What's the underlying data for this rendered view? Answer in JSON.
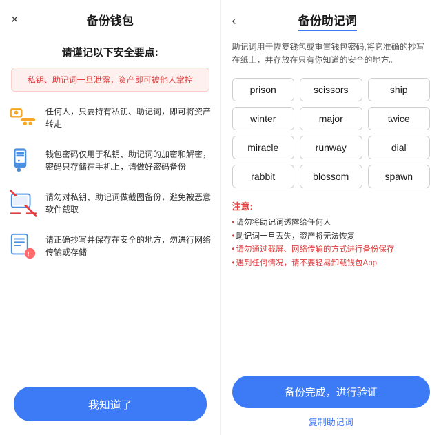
{
  "left": {
    "close_icon": "×",
    "title": "备份钱包",
    "subtitle": "请谨记以下安全要点:",
    "warning": "私钥、助记词一旦泄露，资产即可被他人掌控",
    "security_items": [
      {
        "id": "item1",
        "text": "任何人，只要持有私钥、助记词，即可将资产转走"
      },
      {
        "id": "item2",
        "text": "钱包密码仅用于私钥、助记词的加密和解密，密码只存储在手机上，请做好密码备份"
      },
      {
        "id": "item3",
        "text": "请勿对私钥、助记词做截图备份，避免被恶意软件截取"
      },
      {
        "id": "item4",
        "text": "请正确抄写并保存在安全的地方，勿进行网络传输或存储"
      }
    ],
    "btn_label": "我知道了"
  },
  "right": {
    "back_icon": "‹",
    "title": "备份助记词",
    "description": "助记词用于恢复钱包或重置钱包密码,将它准确的抄写在纸上，并存放在只有你知道的安全的地方。",
    "words": [
      "prison",
      "scissors",
      "ship",
      "winter",
      "major",
      "twice",
      "miracle",
      "runway",
      "dial",
      "rabbit",
      "blossom",
      "spawn"
    ],
    "notes_title": "注意:",
    "notes": [
      {
        "text": "请勿将助记词透露给任何人",
        "red": false
      },
      {
        "text": "助记词一旦丢失，资产将无法恢复",
        "red": false
      },
      {
        "text": "请勿通过截屏、网络传输的方式进行备份保存",
        "red": true
      },
      {
        "text": "遇到任何情况，请不要轻易卸载钱包App",
        "red": true
      }
    ],
    "btn_backup": "备份完成，进行验证",
    "copy_link": "复制助记词"
  }
}
